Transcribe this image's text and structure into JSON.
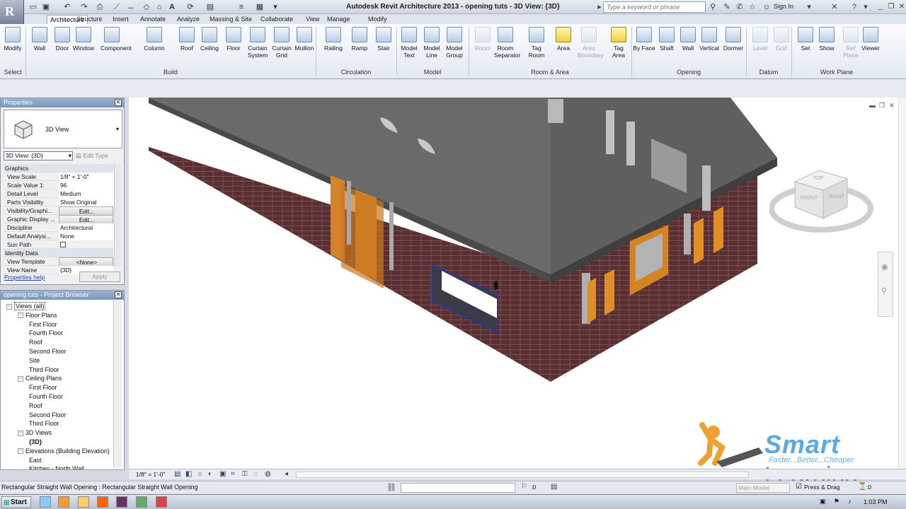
{
  "window": {
    "title": "Autodesk Revit Architecture 2013 -     opening tuts - 3D View: {3D}",
    "search_placeholder": "Type a keyword or phrase",
    "sign_in": "Sign In"
  },
  "tabs": [
    "Architecture",
    "Structure",
    "Insert",
    "Annotate",
    "Analyze",
    "Massing & Site",
    "Collaborate",
    "View",
    "Manage",
    "Modify"
  ],
  "ribbon": {
    "tools": [
      {
        "label": "Modify",
        "icon": "cursor-icon"
      },
      {
        "label": "Wall",
        "icon": "wall-icon"
      },
      {
        "label": "Door",
        "icon": "door-icon"
      },
      {
        "label": "Window",
        "icon": "window-icon"
      },
      {
        "label": "Component",
        "icon": "component-icon"
      },
      {
        "label": "Column",
        "icon": "column-icon"
      },
      {
        "label": "Roof",
        "icon": "roof-icon"
      },
      {
        "label": "Ceiling",
        "icon": "ceiling-icon"
      },
      {
        "label": "Floor",
        "icon": "floor-icon"
      },
      {
        "label": "Curtain System",
        "icon": "curtain-system-icon"
      },
      {
        "label": "Curtain Grid",
        "icon": "curtain-grid-icon"
      },
      {
        "label": "Mullion",
        "icon": "mullion-icon"
      },
      {
        "label": "Railing",
        "icon": "railing-icon"
      },
      {
        "label": "Ramp",
        "icon": "ramp-icon"
      },
      {
        "label": "Stair",
        "icon": "stair-icon"
      },
      {
        "label": "Model Text",
        "icon": "model-text-icon"
      },
      {
        "label": "Model Line",
        "icon": "model-line-icon"
      },
      {
        "label": "Model Group",
        "icon": "model-group-icon"
      },
      {
        "label": "Room",
        "icon": "room-icon",
        "disabled": true
      },
      {
        "label": "Room Separator",
        "icon": "room-separator-icon"
      },
      {
        "label": "Tag Room",
        "icon": "tag-room-icon"
      },
      {
        "label": "Area",
        "icon": "area-icon",
        "yellow": true
      },
      {
        "label": "Area Boundary",
        "icon": "area-boundary-icon",
        "disabled": true
      },
      {
        "label": "Tag Area",
        "icon": "tag-area-icon",
        "yellow": true
      },
      {
        "label": "By Face",
        "icon": "by-face-icon"
      },
      {
        "label": "Shaft",
        "icon": "shaft-icon"
      },
      {
        "label": "Wall",
        "icon": "wall-opening-icon"
      },
      {
        "label": "Vertical",
        "icon": "vertical-icon"
      },
      {
        "label": "Dormer",
        "icon": "dormer-icon"
      },
      {
        "label": "Level",
        "icon": "level-icon",
        "disabled": true
      },
      {
        "label": "Grid",
        "icon": "grid-icon",
        "disabled": true
      },
      {
        "label": "Set",
        "icon": "set-icon"
      },
      {
        "label": "Show",
        "icon": "show-icon"
      },
      {
        "label": "Ref Plane",
        "icon": "ref-plane-icon",
        "disabled": true
      },
      {
        "label": "Viewer",
        "icon": "viewer-icon"
      }
    ],
    "panels": [
      "Select",
      "Build",
      "Circulation",
      "Model",
      "Room & Area",
      "Opening",
      "Datum",
      "Work Plane"
    ]
  },
  "properties": {
    "title": "Properties",
    "type_name": "3D View",
    "view_selector": "3D View: {3D}",
    "edit_type": "Edit Type",
    "rows": [
      {
        "cat": "Graphics"
      },
      {
        "k": "View Scale",
        "v": "1/8\" = 1'-0\""
      },
      {
        "k": "Scale Value    1:",
        "v": "96"
      },
      {
        "k": "Detail Level",
        "v": "Medium"
      },
      {
        "k": "Parts Visibility",
        "v": "Show Original"
      },
      {
        "k": "Visibility/Graphi...",
        "v": "Edit...",
        "btn": true
      },
      {
        "k": "Graphic Display ...",
        "v": "Edit...",
        "btn": true
      },
      {
        "k": "Discipline",
        "v": "Architectural"
      },
      {
        "k": "Default Analysi...",
        "v": "None"
      },
      {
        "k": "Sun Path",
        "v": ""
      },
      {
        "cat": "Identity Data"
      },
      {
        "k": "View Template",
        "v": "<None>",
        "btn": true
      },
      {
        "k": "View Name",
        "v": "{3D}"
      }
    ],
    "help": "Properties help",
    "apply": "Apply"
  },
  "browser": {
    "title": "opening tuts - Project Browser",
    "nodes": [
      {
        "t": "Views (all)",
        "d": 0,
        "tg": "-"
      },
      {
        "t": "Floor Plans",
        "d": 1,
        "tg": "-"
      },
      {
        "t": "First Floor",
        "d": 2
      },
      {
        "t": "Fourth Floor",
        "d": 2
      },
      {
        "t": "Roof",
        "d": 2
      },
      {
        "t": "Second Floor",
        "d": 2
      },
      {
        "t": "Site",
        "d": 2
      },
      {
        "t": "Third Floor",
        "d": 2
      },
      {
        "t": "Ceiling Plans",
        "d": 1,
        "tg": "-"
      },
      {
        "t": "First Floor",
        "d": 2
      },
      {
        "t": "Fourth Floor",
        "d": 2
      },
      {
        "t": "Roof",
        "d": 2
      },
      {
        "t": "Second Floor",
        "d": 2
      },
      {
        "t": "Third Floor",
        "d": 2
      },
      {
        "t": "3D Views",
        "d": 1,
        "tg": "-"
      },
      {
        "t": "{3D}",
        "d": 2,
        "bold": true
      },
      {
        "t": "Elevations (Building Elevation)",
        "d": 1,
        "tg": "-"
      },
      {
        "t": "East",
        "d": 2
      },
      {
        "t": "Kitchen - North Wall",
        "d": 2
      }
    ]
  },
  "viewcube": {
    "top": "TOP",
    "front": "FRONT",
    "right": "RIGHT"
  },
  "view_bar": {
    "scale": "1/8\" = 1'-0\""
  },
  "status": {
    "text": "Rectangular Straight Wall Opening : Rectangular Straight Wall Opening",
    "count": ":0",
    "model": "Main Model",
    "press_drag": "Press & Drag",
    "filter": ":0"
  },
  "taskbar": {
    "start": "Start",
    "clock": "1:03 PM"
  },
  "logo": {
    "brand": "Smart",
    "tagline": "Faster...Better...Cheaper",
    "word": "Learning"
  },
  "colors": {
    "brick": "#5a2e2e",
    "roof": "#6b6b6b",
    "door": "#d98a25",
    "selection": "#1f3bb0"
  }
}
